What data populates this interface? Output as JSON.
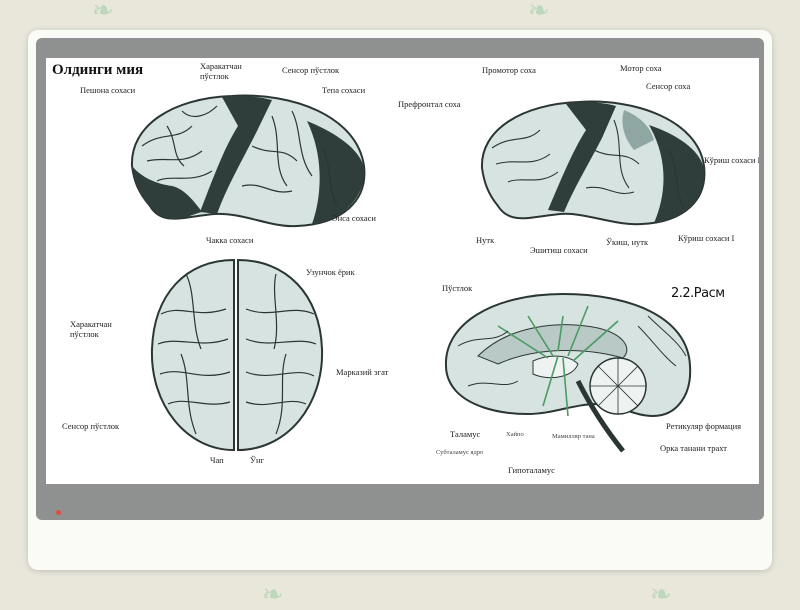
{
  "figure": {
    "title": "Олдинги мия",
    "caption": "2.2.Расм"
  },
  "labels": {
    "tl": [
      "Пешона сохаси",
      "Харакатчан",
      "пўстлок",
      "Сенсор пўстлок",
      "Тепа сохаси",
      "Энса сохаси",
      "Чакка сохаси"
    ],
    "tr": [
      "Промотор соха",
      "Мотор соха",
      "Сенсор соха",
      "Префронтал соха",
      "Кўриш сохаси II",
      "Кўриш сохаси I",
      "Нутк",
      "Эшитиш сохаси",
      "Ўкиш, нутк"
    ],
    "bl": [
      "Узунчок ёрик",
      "Харакатчан",
      "пўстлок",
      "Марказий эгат",
      "Сенсор пўстлок",
      "Чап",
      "Ўнг"
    ],
    "br": [
      "Пўстлок",
      "Таламус",
      "Хайпо",
      "Гипоталамус",
      "Ретикуляр формация",
      "Орка танани трахт",
      "Субталамус ядро",
      "Мамилляр тана"
    ]
  },
  "colors": {
    "background": "#e9e6da",
    "card": "#fafaf7",
    "slide": "#8f9190",
    "brain_fill": "#d7e3e0",
    "brain_dark": "#2f3d3b",
    "brain_line": "#2b3634",
    "green": "#4a9b63",
    "leaf": "#a9d2ae"
  },
  "icons": [
    "leaf-icon"
  ]
}
